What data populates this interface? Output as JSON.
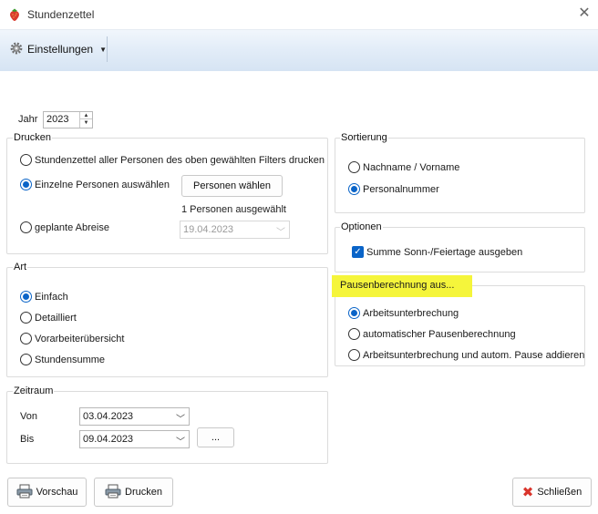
{
  "window": {
    "title": "Stundenzettel"
  },
  "toolbar": {
    "settings_label": "Einstellungen"
  },
  "jahr": {
    "label": "Jahr",
    "value": "2023"
  },
  "drucken": {
    "title": "Drucken",
    "option_all": "Stundenzettel aller Personen des oben gewählten Filters drucken",
    "option_single": "Einzelne Personen auswählen",
    "select_button": "Personen wählen",
    "selected_count": "1 Personen ausgewählt",
    "option_departure": "geplante Abreise",
    "departure_date": "19.04.2023"
  },
  "art": {
    "title": "Art",
    "options": [
      "Einfach",
      "Detailliert",
      "Vorarbeiterübersicht",
      "Stundensumme"
    ]
  },
  "zeitraum": {
    "title": "Zeitraum",
    "von_label": "Von",
    "von_value": "03.04.2023",
    "bis_label": "Bis",
    "bis_value": "09.04.2023",
    "more_button": "..."
  },
  "sortierung": {
    "title": "Sortierung",
    "options": [
      "Nachname / Vorname",
      "Personalnummer"
    ]
  },
  "optionen": {
    "title": "Optionen",
    "checkbox_label": "Summe Sonn-/Feiertage ausgeben"
  },
  "pausen": {
    "title": "Pausenberechnung aus...",
    "options": [
      "Arbeitsunterbrechung",
      "automatischer Pausenberechnung",
      "Arbeitsunterbrechung und autom. Pause addieren"
    ]
  },
  "footer": {
    "preview_label": "Vorschau",
    "print_label": "Drucken",
    "close_label": "Schließen"
  },
  "colors": {
    "accent": "#0a64c8",
    "highlight": "#f5f53b",
    "close_icon": "#d9342b"
  }
}
